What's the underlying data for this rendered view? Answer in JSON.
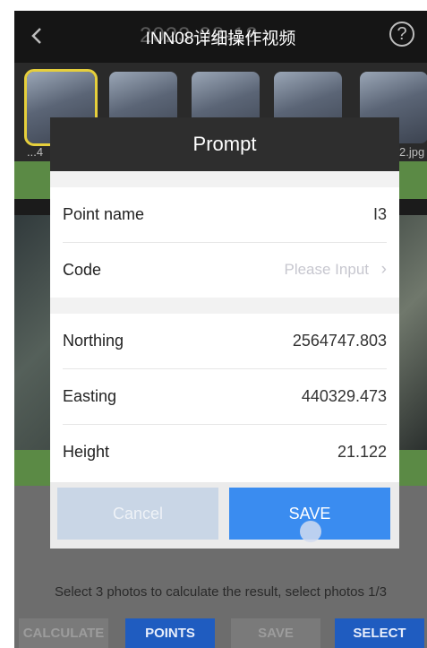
{
  "header": {
    "title": "INN08详细操作视频",
    "title_ghost": "2023-08-18"
  },
  "thumbnails": {
    "left_label": "...4",
    "right_label": "2.jpg"
  },
  "dialog": {
    "title": "Prompt",
    "point_name": {
      "label": "Point name",
      "value": "I3"
    },
    "code": {
      "label": "Code",
      "placeholder": "Please Input"
    },
    "northing": {
      "label": "Northing",
      "value": "2564747.803"
    },
    "easting": {
      "label": "Easting",
      "value": "440329.473"
    },
    "height": {
      "label": "Height",
      "value": "21.122"
    },
    "cancel_label": "Cancel",
    "save_label": "SAVE"
  },
  "status_text": "Select 3 photos to calculate the result, select photos 1/3",
  "bottom_buttons": {
    "calculate": "CALCULATE",
    "points": "POINTS",
    "save": "SAVE",
    "select": "SELECT"
  },
  "colors": {
    "accent": "#3a8cf0",
    "active_button": "#1f5cc0",
    "selection": "#e6cf3c",
    "green_bar": "#5b8a45"
  },
  "icons": {
    "back": "chevron-left-icon",
    "help": "question-circle-icon",
    "code_arrow": "chevron-right-icon"
  }
}
